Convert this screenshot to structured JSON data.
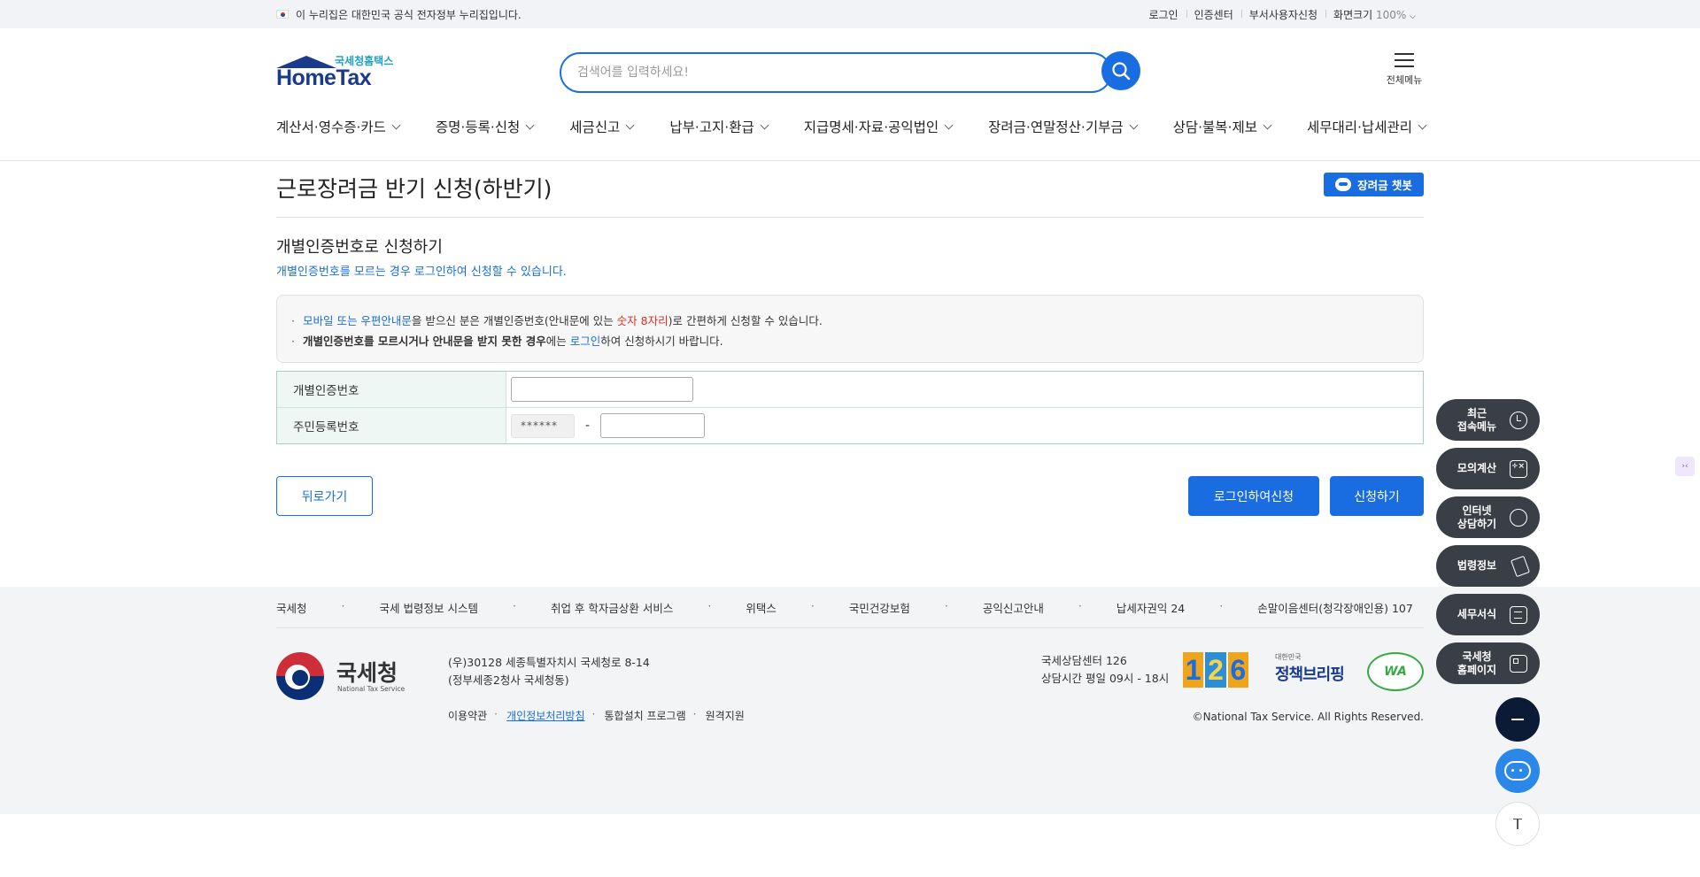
{
  "topbar": {
    "gov_notice": "이 누리집은 대한민국 공식 전자정부 누리집입니다.",
    "links": [
      "로그인",
      "인증센터",
      "부서사용자신청"
    ],
    "zoom_label": "화면크기",
    "zoom_value": "100%"
  },
  "header": {
    "logo_sub": "국세청홈택스",
    "logo_main": "HomeTax",
    "search_placeholder": "검색어를 입력하세요!",
    "all_menu": "전체메뉴",
    "nav": [
      "계산서·영수증·카드",
      "증명·등록·신청",
      "세금신고",
      "납부·고지·환급",
      "지급명세·자료·공익법인",
      "장려금·연말정산·기부금",
      "상담·불복·제보",
      "세무대리·납세관리"
    ]
  },
  "main": {
    "page_title": "근로장려금 반기 신청(하반기)",
    "chatbot_label": "장려금 챗봇",
    "section_title": "개별인증번호로 신청하기",
    "section_sub": "개별인증번호를 모르는 경우 로그인하여 신청할 수 있습니다.",
    "notice": {
      "line1_blue": "모바일 또는 우편안내문",
      "line1_a": "을 받으신 분은 개별인증번호(안내문에 있는 ",
      "line1_red": "숫자 8자리",
      "line1_b": ")로 간편하게 신청할 수 있습니다.",
      "line2_bold": "개별인증번호를 모르시거나 안내문을 받지 못한 경우",
      "line2_a": "에는 ",
      "line2_blue": "로그인",
      "line2_b": "하여 신청하시기 바랍니다."
    },
    "form": {
      "cert_label": "개별인증번호",
      "cert_value": "",
      "rrn_label": "주민등록번호",
      "rrn_masked": "******",
      "rrn_dash": "-",
      "rrn_back_value": ""
    },
    "buttons": {
      "back": "뒤로가기",
      "login_apply": "로그인하여신청",
      "apply": "신청하기"
    }
  },
  "footer": {
    "links": [
      "국세청",
      "국세 법령정보 시스템",
      "취업 후 학자금상환 서비스",
      "위택스",
      "국민건강보험",
      "공익신고안내",
      "납세자권익 24",
      "손말이음센터(청각장애인용) 107"
    ],
    "logo_ko": "국세청",
    "logo_en": "National Tax Service",
    "address_1": "(우)30128 세종특별자치시 국세청로 8-14",
    "address_2": "(정부세종2청사 국세청동)",
    "menu": [
      "이용약관",
      "개인정보처리방침",
      "통합설치 프로그램",
      "원격지원"
    ],
    "center_title": "국세상담센터 126",
    "center_hours": "상담시간 평일 09시 - 18시",
    "badge_126": [
      "1",
      "2",
      "6"
    ],
    "policy_small": "대한민국",
    "policy_main": "정책브리핑",
    "wa_label": "WA",
    "copyright": "©National Tax Service. All Rights Reserved."
  },
  "quick_menu": [
    {
      "label": "최근 접속메뉴",
      "icon": "clock-icon"
    },
    {
      "label": "모의계산",
      "icon": "calculator-icon"
    },
    {
      "label": "인터넷 상담하기",
      "icon": "chat-icon"
    },
    {
      "label": "법령정보",
      "icon": "gavel-icon"
    },
    {
      "label": "세무서식",
      "icon": "document-icon"
    },
    {
      "label": "국세청 홈페이지",
      "icon": "building-icon"
    }
  ],
  "colors": {
    "primary": "#1a6de0",
    "quick_bg": "#3a3f47",
    "form_label_bg": "#eef7f4",
    "highlight_red": "#e0301e"
  }
}
